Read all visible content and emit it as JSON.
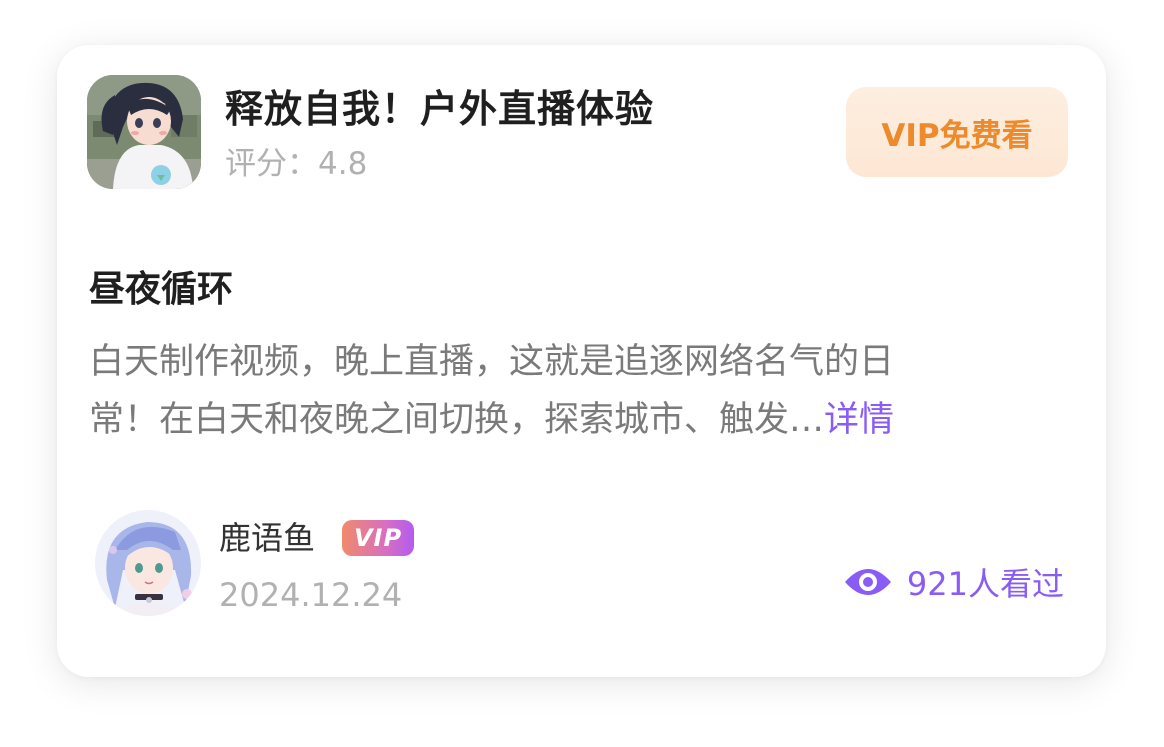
{
  "game": {
    "title": "释放自我！户外直播体验",
    "rating_label": "评分：",
    "rating_value": "4.8",
    "cover_icon": "anime-girl-cover-image",
    "watch_button_label": "VIP免费看"
  },
  "section": {
    "title": "昼夜循环",
    "description_line1": "白天制作视频，晚上直播，这就是追逐网络名气的日",
    "description_line2": "常！在白天和夜晚之间切换，探索城市、触发…",
    "detail_link": "详情"
  },
  "author": {
    "name": "鹿语鱼",
    "badge": "VIP",
    "date": "2024.12.24",
    "avatar_icon": "anime-avatar-image"
  },
  "stats": {
    "views_text": "921人看过",
    "views_icon": "eye-icon"
  },
  "colors": {
    "accent_purple": "#8a5cf6",
    "vip_orange": "#ec8a2c",
    "vip_bg": "#fde9d7",
    "title_text": "#1f1f1f",
    "muted_text": "#b1b1b1",
    "body_text": "#7a7a7a"
  }
}
